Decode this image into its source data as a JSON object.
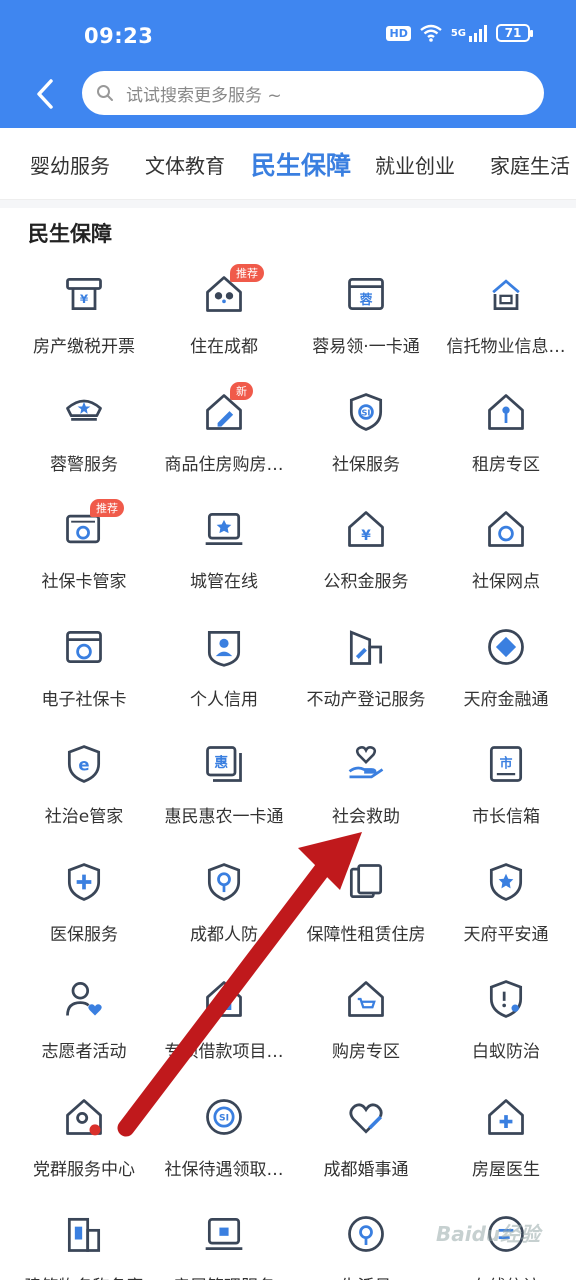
{
  "status_bar": {
    "time": "09:23",
    "hd": "HD",
    "network": "5G",
    "battery": "71"
  },
  "search": {
    "placeholder": "试试搜索更多服务 ~"
  },
  "tabs": [
    {
      "label": "婴幼服务"
    },
    {
      "label": "文体教育"
    },
    {
      "label": "民生保障"
    },
    {
      "label": "就业创业"
    },
    {
      "label": "家庭生活"
    }
  ],
  "section": {
    "title": "民生保障"
  },
  "services": [
    {
      "label": "房产缴税开票",
      "icon": "atm-yuan-icon"
    },
    {
      "label": "住在成都",
      "icon": "panda-house-icon",
      "badge": "推荐"
    },
    {
      "label": "蓉易领·一卡通",
      "icon": "card-rong-icon"
    },
    {
      "label": "信托物业信息…",
      "icon": "property-trust-icon"
    },
    {
      "label": "蓉警服务",
      "icon": "police-cap-icon"
    },
    {
      "label": "商品住房购房…",
      "icon": "house-pen-icon",
      "badge": "新"
    },
    {
      "label": "社保服务",
      "icon": "si-shield-icon"
    },
    {
      "label": "租房专区",
      "icon": "house-key-icon"
    },
    {
      "label": "社保卡管家",
      "icon": "si-card-icon",
      "badge": "推荐"
    },
    {
      "label": "城管在线",
      "icon": "monitor-star-icon"
    },
    {
      "label": "公积金服务",
      "icon": "house-yuan-icon"
    },
    {
      "label": "社保网点",
      "icon": "house-si-icon"
    },
    {
      "label": "电子社保卡",
      "icon": "e-si-card-icon"
    },
    {
      "label": "个人信用",
      "icon": "person-shield-icon"
    },
    {
      "label": "不动产登记服务",
      "icon": "building-pen-icon"
    },
    {
      "label": "天府金融通",
      "icon": "finance-diamond-icon"
    },
    {
      "label": "社治e管家",
      "icon": "e-shield-icon"
    },
    {
      "label": "惠民惠农一卡通",
      "icon": "hui-card-icon"
    },
    {
      "label": "社会救助",
      "icon": "heart-hand-icon"
    },
    {
      "label": "市长信箱",
      "icon": "mayor-mailbox-icon"
    },
    {
      "label": "医保服务",
      "icon": "medical-shield-icon"
    },
    {
      "label": "成都人防",
      "icon": "civil-defense-icon"
    },
    {
      "label": "保障性租赁住房",
      "icon": "housing-cards-icon"
    },
    {
      "label": "天府平安通",
      "icon": "star-shield-icon"
    },
    {
      "label": "志愿者活动",
      "icon": "volunteer-heart-icon"
    },
    {
      "label": "专项借款项目…",
      "icon": "special-loan-icon"
    },
    {
      "label": "购房专区",
      "icon": "house-cart-icon"
    },
    {
      "label": "白蚁防治",
      "icon": "termite-shield-icon"
    },
    {
      "label": "党群服务中心",
      "icon": "party-center-icon"
    },
    {
      "label": "社保待遇领取…",
      "icon": "si-circle-icon"
    },
    {
      "label": "成都婚事通",
      "icon": "marriage-heart-icon"
    },
    {
      "label": "房屋医生",
      "icon": "house-doctor-icon"
    },
    {
      "label": "建筑物名称备案",
      "icon": "buildings-icon"
    },
    {
      "label": "房屋管理服务",
      "icon": "monitor-lock-icon"
    },
    {
      "label": "生活号",
      "icon": "life-account-icon"
    },
    {
      "label": "在线信访",
      "icon": "online-petition-icon"
    }
  ],
  "watermark": {
    "text": "Baidu经验"
  },
  "colors": {
    "header": "#3f86f0",
    "tab_active": "#3a7fe0",
    "icon_stroke": "#3a4658",
    "icon_accent": "#3a7fe0",
    "badge": "#f05a4a",
    "annotation_arrow": "#c0191c"
  }
}
